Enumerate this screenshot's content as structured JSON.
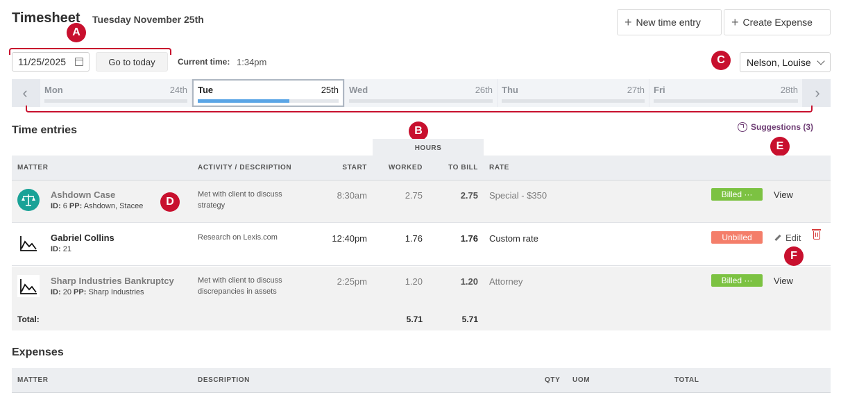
{
  "header": {
    "title": "Timesheet",
    "date_label": "Tuesday November 25th",
    "new_time_entry": "New time entry",
    "create_expense": "Create Expense"
  },
  "controls": {
    "date_value": "11/25/2025",
    "go_to_today": "Go to today",
    "current_time_label": "Current time:",
    "current_time_value": "1:34pm",
    "user": "Nelson, Louise"
  },
  "week": {
    "days": [
      {
        "name": "Mon",
        "date": "24th",
        "progress": 0
      },
      {
        "name": "Tue",
        "date": "25th",
        "progress": 0.65,
        "selected": true
      },
      {
        "name": "Wed",
        "date": "26th",
        "progress": 0
      },
      {
        "name": "Thu",
        "date": "27th",
        "progress": 0
      },
      {
        "name": "Fri",
        "date": "28th",
        "progress": 0
      }
    ]
  },
  "annotations": {
    "a": "A",
    "b": "B",
    "c": "C",
    "d": "D",
    "e": "E",
    "f": "F"
  },
  "time_entries": {
    "title": "Time entries",
    "suggestions": "Suggestions (3)",
    "hours_label": "HOURS",
    "columns": {
      "matter": "MATTER",
      "activity": "ACTIVITY / DESCRIPTION",
      "start": "START",
      "worked": "WORKED",
      "to_bill": "TO BILL",
      "rate": "RATE"
    },
    "rows": [
      {
        "matter": "Ashdown Case",
        "id_label": "ID:",
        "id": "6",
        "pp_label": "PP:",
        "pp": "Ashdown, Stacee",
        "description": "Met with client to discuss strategy",
        "start": "8:30am",
        "worked": "2.75",
        "to_bill": "2.75",
        "rate": "Special - $350",
        "status": "Billed ···",
        "action": "View"
      },
      {
        "matter": "Gabriel Collins",
        "id_label": "ID:",
        "id": "21",
        "description": "Research on Lexis.com",
        "start": "12:40pm",
        "worked": "1.76",
        "to_bill": "1.76",
        "rate": "Custom rate",
        "status": "Unbilled",
        "action": "Edit"
      },
      {
        "matter": "Sharp Industries Bankruptcy",
        "id_label": "ID:",
        "id": "20",
        "pp_label": "PP:",
        "pp": "Sharp Industries",
        "description": "Met with client to discuss discrepancies in assets",
        "start": "2:25pm",
        "worked": "1.20",
        "to_bill": "1.20",
        "rate": "Attorney",
        "status": "Billed ···",
        "action": "View"
      }
    ],
    "total_label": "Total:",
    "total_worked": "5.71",
    "total_to_bill": "5.71"
  },
  "expenses": {
    "title": "Expenses",
    "columns": {
      "matter": "MATTER",
      "description": "DESCRIPTION",
      "qty": "QTY",
      "uom": "UOM",
      "total": "TOTAL"
    }
  },
  "colors": {
    "accent_red": "#c8102e",
    "billed_green": "#7cc242",
    "unbilled_salmon": "#f47e6a",
    "progress_blue": "#5aa5e6",
    "suggest_purple": "#6e3d74"
  }
}
